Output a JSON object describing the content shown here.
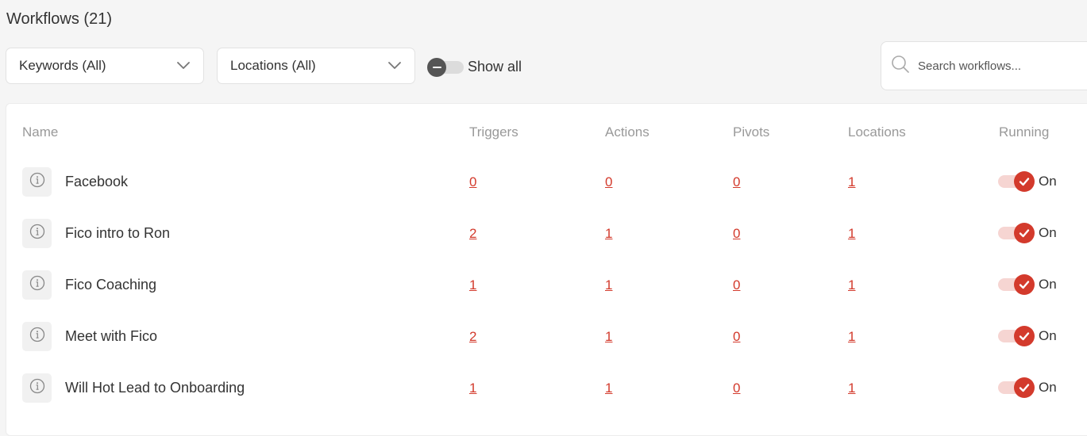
{
  "page": {
    "title": "Workflows (21)"
  },
  "filters": {
    "keywords_label": "Keywords (All)",
    "locations_label": "Locations (All)",
    "show_all_label": "Show all",
    "show_all_on": false
  },
  "search": {
    "placeholder": "Search workflows..."
  },
  "table": {
    "columns": {
      "name": "Name",
      "triggers": "Triggers",
      "actions": "Actions",
      "pivots": "Pivots",
      "locations": "Locations",
      "running": "Running"
    },
    "rows": [
      {
        "name": "Facebook",
        "triggers": "0",
        "actions": "0",
        "pivots": "0",
        "locations": "1",
        "running": "On"
      },
      {
        "name": "Fico intro to Ron",
        "triggers": "2",
        "actions": "1",
        "pivots": "0",
        "locations": "1",
        "running": "On"
      },
      {
        "name": "Fico Coaching",
        "triggers": "1",
        "actions": "1",
        "pivots": "0",
        "locations": "1",
        "running": "On"
      },
      {
        "name": "Meet with Fico",
        "triggers": "2",
        "actions": "1",
        "pivots": "0",
        "locations": "1",
        "running": "On"
      },
      {
        "name": "Will Hot Lead to Onboarding",
        "triggers": "1",
        "actions": "1",
        "pivots": "0",
        "locations": "1",
        "running": "On"
      }
    ]
  },
  "colors": {
    "accent": "#d33a2c",
    "accent_light": "#f6d5d2",
    "muted_text": "#999999",
    "background": "#f5f5f5"
  },
  "icons": {
    "dropdown": "chevron-down-icon",
    "search": "search-icon",
    "info": "info-icon",
    "check": "check-icon",
    "toggle_off": "minus-icon"
  }
}
